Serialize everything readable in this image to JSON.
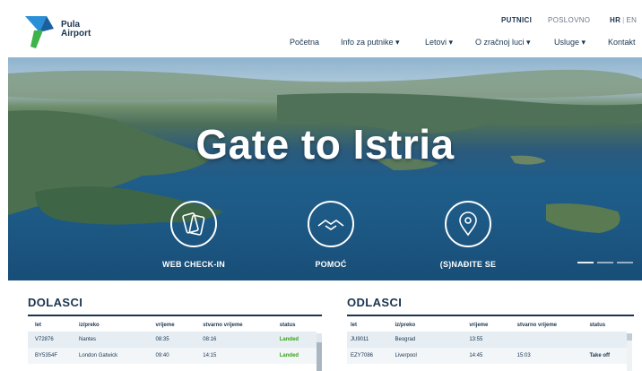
{
  "brand": {
    "line1": "Pula",
    "line2": "Airport"
  },
  "top_nav": {
    "putnici": "PUTNICI",
    "poslovno": "POSLOVNO",
    "lang_hr": "HR",
    "lang_sep": "|",
    "lang_en": "EN"
  },
  "main_nav": [
    {
      "label": "Početna"
    },
    {
      "label": "Info za putnike ▾"
    },
    {
      "label": "Letovi ▾"
    },
    {
      "label": "O zračnoj luci ▾"
    },
    {
      "label": "Usluge ▾"
    },
    {
      "label": "Kontakt"
    }
  ],
  "hero": {
    "headline": "Gate to Istria",
    "actions": [
      {
        "label": "WEB CHECK-IN",
        "icon": "boarding-pass-icon"
      },
      {
        "label": "POMOĆ",
        "icon": "handshake-icon"
      },
      {
        "label": "(S)NAĐITE SE",
        "icon": "location-pin-icon"
      }
    ]
  },
  "arrivals": {
    "title": "DOLASCI",
    "headers": [
      "let",
      "iz/preko",
      "vrijeme",
      "stvarno vrijeme",
      "status"
    ],
    "rows": [
      [
        "V72876",
        "Nantes",
        "08:35",
        "08:16",
        "Landed"
      ],
      [
        "BY5354F",
        "London Gatwick",
        "09:40",
        "14:15",
        "Landed"
      ]
    ]
  },
  "departures": {
    "title": "ODLASCI",
    "headers": [
      "let",
      "iz/preko",
      "vrijeme",
      "stvarno vrijeme",
      "status"
    ],
    "rows": [
      [
        "JU9011",
        "Beograd",
        "13:55",
        "",
        ""
      ],
      [
        "EZY7086",
        "Liverpool",
        "14:45",
        "15:03",
        "Take off"
      ]
    ]
  },
  "colors": {
    "navy": "#1a3550",
    "landed": "#3aa11a",
    "logo_blue": "#2a8fd6",
    "logo_green": "#3db34a"
  }
}
